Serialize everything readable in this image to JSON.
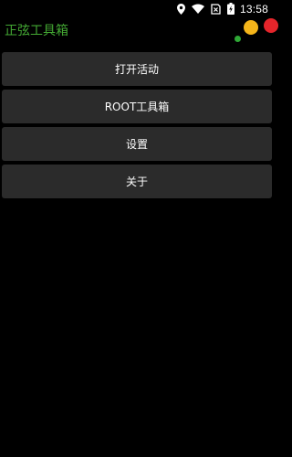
{
  "status_bar": {
    "time": "13:58",
    "icons": [
      "location-icon",
      "wifi-icon",
      "no-sim-icon",
      "battery-charging-icon"
    ]
  },
  "app": {
    "title": "正弦工具箱",
    "title_color": "#43a833",
    "decoration_colors": [
      "#f4b51a",
      "#e5252b",
      "#2fa836"
    ]
  },
  "menu": {
    "items": [
      {
        "label": "打开活动"
      },
      {
        "label": "ROOT工具箱"
      },
      {
        "label": "设置"
      },
      {
        "label": "关于"
      }
    ]
  },
  "colors": {
    "background": "#000000",
    "button_bg": "#2b2b2b",
    "text": "#ffffff"
  }
}
